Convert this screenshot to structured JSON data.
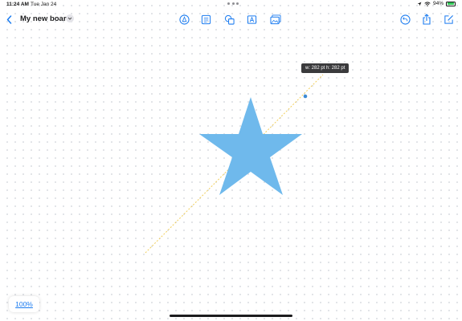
{
  "status_bar": {
    "time": "11:24 AM",
    "date": "Tue Jan 24",
    "battery": "94%",
    "battery_level": 0.94
  },
  "toolbar": {
    "title": "My new board",
    "icons": [
      "back-chevron-icon",
      "pen-tool-icon",
      "sticky-note-icon",
      "shapes-icon",
      "text-box-icon",
      "media-icon",
      "undo-icon",
      "share-icon",
      "new-board-icon"
    ]
  },
  "canvas": {
    "shape": "star",
    "shape_color": "#6fb9ec",
    "size_label": "w: 282 pt  h: 282 pt"
  },
  "zoom": {
    "level": "100%"
  },
  "colors": {
    "accent": "#1a7bf0",
    "guide_line": "#f2cf5b",
    "handle": "#3d8bd4"
  }
}
